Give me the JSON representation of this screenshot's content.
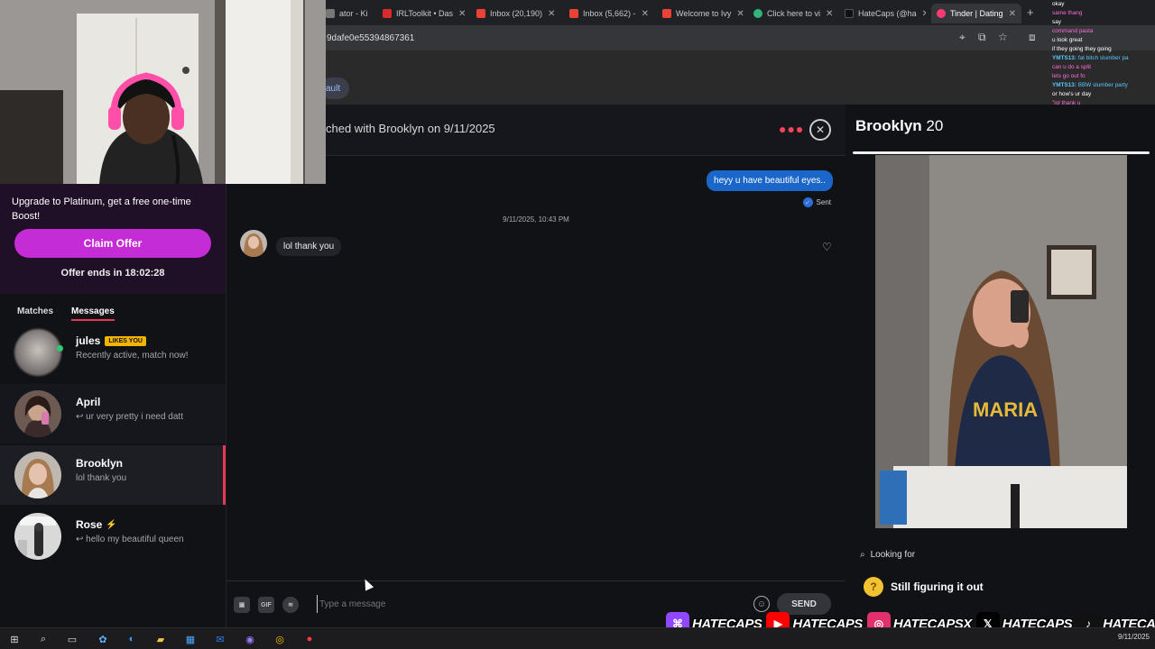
{
  "browser": {
    "tabs": [
      {
        "label": "ator - Ki",
        "color": "#888888"
      },
      {
        "label": "IRLToolkit • Das",
        "color": "#d82b2b"
      },
      {
        "label": "Inbox (20,190)",
        "color": "#ea4335"
      },
      {
        "label": "Inbox (5,662) -",
        "color": "#ea4335"
      },
      {
        "label": "Welcome to Ivy",
        "color": "#ea4335"
      },
      {
        "label": "Click here to vi",
        "color": "#2fb57a"
      },
      {
        "label": "HateCaps (@ha",
        "color": "#111111"
      },
      {
        "label": "Tinder | Dating",
        "color": "#fe3c72"
      }
    ],
    "url": "9dafe0e55394867361",
    "page_pill": "ault"
  },
  "promo": {
    "text": "Upgrade to Platinum, get a free one-time Boost!",
    "button": "Claim Offer",
    "ends": "Offer ends in 18:02:28"
  },
  "sidebar": {
    "tab_matches": "Matches",
    "tab_messages": "Messages",
    "conversations": [
      {
        "name": "jules",
        "badge": "LIKES YOU",
        "preview": "Recently active, match now!"
      },
      {
        "name": "April",
        "preview": "↩ ur very pretty i need datt"
      },
      {
        "name": "Brooklyn",
        "preview": "lol thank you"
      },
      {
        "name": "Rose",
        "preview": "↩ hello my beautiful queen"
      }
    ]
  },
  "chat": {
    "matched": "ched with Brooklyn on 9/11/2025",
    "outgoing": "heyy u have beautiful eyes..",
    "sent_label": "Sent",
    "timestamp": "9/11/2025, 10:43 PM",
    "incoming": "lol thank you",
    "placeholder": "Type a message",
    "send": "SEND",
    "gif": "GIF"
  },
  "profile": {
    "name": "Brooklyn",
    "age": "20",
    "looking_for_label": "Looking for",
    "looking_for_value": "Still figuring it out"
  },
  "stream_chat": [
    {
      "user": "",
      "msg": "okay",
      "color": "#ffffff"
    },
    {
      "user": "",
      "msg": "same thang",
      "color": "#ff6ad5"
    },
    {
      "user": "",
      "msg": "say",
      "color": "#ffffff"
    },
    {
      "user": "",
      "msg": "command pasta",
      "color": "#ff6ad5"
    },
    {
      "user": "",
      "msg": "u look great",
      "color": "#ffffff"
    },
    {
      "user": "",
      "msg": "if they going they going",
      "color": "#ffffff"
    },
    {
      "user": "YMTS13:",
      "msg": "fat bitch slumber pa",
      "color": "#58c7ff"
    },
    {
      "user": "",
      "msg": "can u do a split",
      "color": "#ff6ad5"
    },
    {
      "user": "",
      "msg": "lets go out fo",
      "color": "#ff6ad5"
    },
    {
      "user": "YMTS13:",
      "msg": "BBW slumber party",
      "color": "#58c7ff"
    },
    {
      "user": "",
      "msg": "or how's ur day",
      "color": "#ffffff"
    },
    {
      "user": "",
      "msg": "\"lol thank u",
      "color": "#ff6ad5"
    }
  ],
  "socials": [
    {
      "icon": "twitch-icon",
      "color": "#9146ff",
      "glyph": "⌘",
      "text": "HATECAPS"
    },
    {
      "icon": "youtube-icon",
      "color": "#ff0000",
      "glyph": "▶",
      "text": "HATECAPS"
    },
    {
      "icon": "instagram-icon",
      "color": "#e1306c",
      "glyph": "◎",
      "text": "HATECAPSX"
    },
    {
      "icon": "x-icon",
      "color": "#000000",
      "glyph": "𝕏",
      "text": "HATECAPS"
    },
    {
      "icon": "tiktok-icon",
      "color": "#111111",
      "glyph": "♪",
      "text": "HATECAPS"
    }
  ],
  "taskbar": {
    "date": "9/11/2025"
  }
}
